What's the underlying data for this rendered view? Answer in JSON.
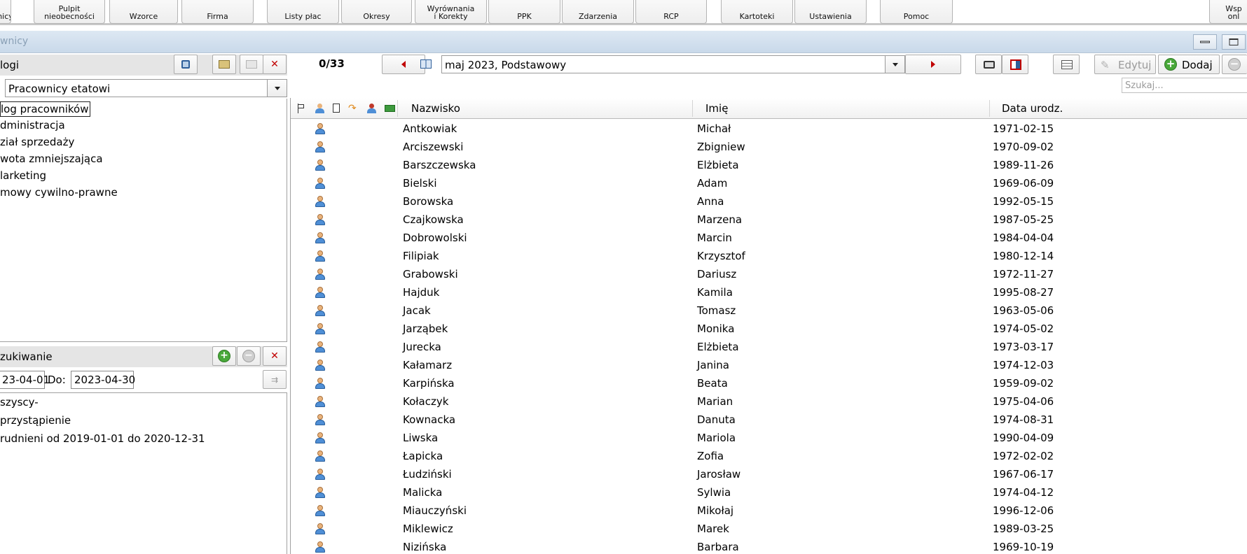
{
  "ribbon": {
    "buttons": [
      {
        "label": "wnicy"
      },
      {
        "label": "Pulpit\nnieobecności"
      },
      {
        "label": "Wzorce"
      },
      {
        "label": "Firma"
      },
      {
        "label": "Listy płac"
      },
      {
        "label": "Okresy"
      },
      {
        "label": "Wyrównania\ni Korekty"
      },
      {
        "label": "PPK"
      },
      {
        "label": "Zdarzenia"
      },
      {
        "label": "RCP"
      },
      {
        "label": "Kartoteki"
      },
      {
        "label": "Ustawienia"
      },
      {
        "label": "Pomoc"
      },
      {
        "label": "Wsp\nonl"
      }
    ]
  },
  "window": {
    "title": "wnicy"
  },
  "catalogs": {
    "header": "logi",
    "dropdown_value": "Pracownicy etatowi",
    "tree": [
      {
        "label": "log pracowników",
        "selected": true
      },
      {
        "label": "dministracja"
      },
      {
        "label": "ział sprzedaży"
      },
      {
        "label": "wota zmniejszająca"
      },
      {
        "label": "larketing"
      },
      {
        "label": "mowy cywilno-prawne"
      }
    ]
  },
  "search_panel": {
    "header": "zukiwanie",
    "date_from": "23-04-01",
    "to_label": "Do:",
    "date_to": "2023-04-30",
    "filters": [
      {
        "label": "szyscy-"
      },
      {
        "label": " przystąpienie"
      },
      {
        "label": "rudnieni od 2019-01-01 do 2020-12-31"
      }
    ]
  },
  "toolbar": {
    "counter": "0/33",
    "period": "maj 2023, Podstawowy",
    "edit_label": "Edytuj",
    "add_label": "Dodaj",
    "search_placeholder": "Szukaj..."
  },
  "grid": {
    "columns": {
      "surname": "Nazwisko",
      "name": "Imię",
      "birth": "Data urodz."
    },
    "rows": [
      {
        "surname": "Antkowiak",
        "name": "Michał",
        "birth": "1971-02-15"
      },
      {
        "surname": "Arciszewski",
        "name": "Zbigniew",
        "birth": "1970-09-02"
      },
      {
        "surname": "Barszczewska",
        "name": "Elżbieta",
        "birth": "1989-11-26"
      },
      {
        "surname": "Bielski",
        "name": "Adam",
        "birth": "1969-06-09"
      },
      {
        "surname": "Borowska",
        "name": "Anna",
        "birth": "1992-05-15"
      },
      {
        "surname": "Czajkowska",
        "name": "Marzena",
        "birth": "1987-05-25"
      },
      {
        "surname": "Dobrowolski",
        "name": "Marcin",
        "birth": "1984-04-04"
      },
      {
        "surname": "Filipiak",
        "name": "Krzysztof",
        "birth": "1980-12-14"
      },
      {
        "surname": "Grabowski",
        "name": "Dariusz",
        "birth": "1972-11-27"
      },
      {
        "surname": "Hajduk",
        "name": "Kamila",
        "birth": "1995-08-27"
      },
      {
        "surname": "Jacak",
        "name": "Tomasz",
        "birth": "1963-05-06"
      },
      {
        "surname": "Jarząbek",
        "name": "Monika",
        "birth": "1974-05-02"
      },
      {
        "surname": "Jurecka",
        "name": "Elżbieta",
        "birth": "1973-03-17"
      },
      {
        "surname": "Kałamarz",
        "name": "Janina",
        "birth": "1974-12-03"
      },
      {
        "surname": "Karpińska",
        "name": "Beata",
        "birth": "1959-09-02"
      },
      {
        "surname": "Kołaczyk",
        "name": "Marian",
        "birth": "1975-04-06"
      },
      {
        "surname": "Kownacka",
        "name": "Danuta",
        "birth": "1974-08-31"
      },
      {
        "surname": "Liwska",
        "name": "Mariola",
        "birth": "1990-04-09"
      },
      {
        "surname": "Łapicka",
        "name": "Zofia",
        "birth": "1972-02-02"
      },
      {
        "surname": "Łudziński",
        "name": "Jarosław",
        "birth": "1967-06-17"
      },
      {
        "surname": "Malicka",
        "name": "Sylwia",
        "birth": "1974-04-12"
      },
      {
        "surname": "Miauczyński",
        "name": "Mikołaj",
        "birth": "1996-12-06"
      },
      {
        "surname": "Miklewicz",
        "name": "Marek",
        "birth": "1989-03-25"
      },
      {
        "surname": "Nizińska",
        "name": "Barbara",
        "birth": "1969-10-19"
      }
    ]
  }
}
